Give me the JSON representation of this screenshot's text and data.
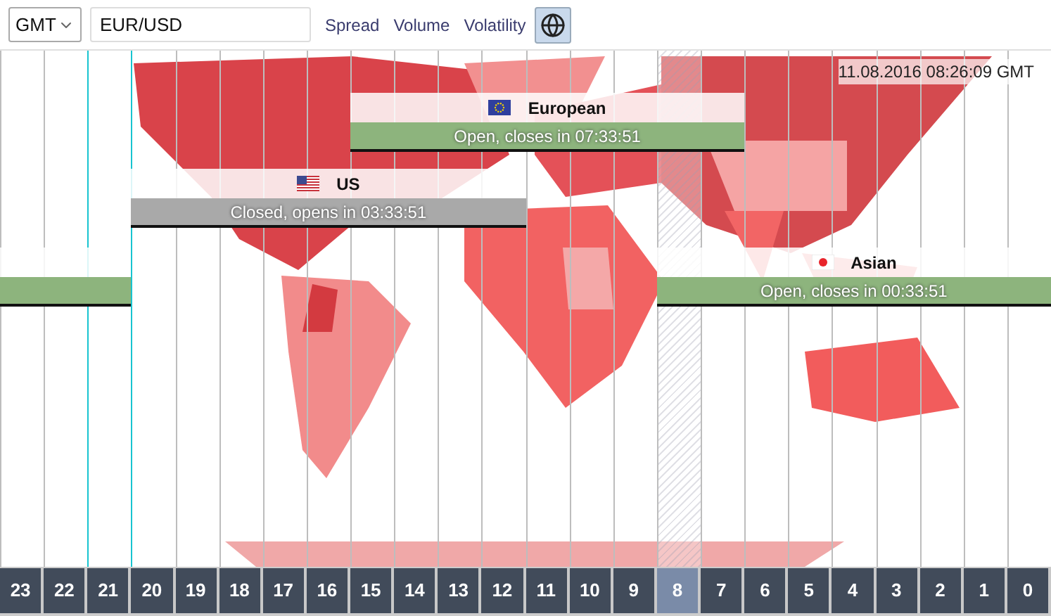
{
  "timezone": {
    "value": "GMT"
  },
  "symbol": {
    "value": "EUR/USD"
  },
  "links": [
    "Spread",
    "Volume",
    "Volatility"
  ],
  "globe_button": {
    "selected": true
  },
  "timestamp": "11.08.2016 08:26:09 GMT",
  "sessions": [
    {
      "name": "European",
      "kind": "eu",
      "open": true,
      "status": "Open, closes in 07:33:51"
    },
    {
      "name": "US",
      "kind": "us",
      "open": false,
      "status": "Closed, opens in 03:33:51"
    },
    {
      "name": "Asian",
      "kind": "jp",
      "open": true,
      "status": "Open, closes in 00:33:51"
    }
  ],
  "hours": [
    {
      "label": "23",
      "selected": false
    },
    {
      "label": "22",
      "selected": false
    },
    {
      "label": "21",
      "selected": false
    },
    {
      "label": "20",
      "selected": false
    },
    {
      "label": "19",
      "selected": false
    },
    {
      "label": "18",
      "selected": false
    },
    {
      "label": "17",
      "selected": false
    },
    {
      "label": "16",
      "selected": false
    },
    {
      "label": "15",
      "selected": false
    },
    {
      "label": "14",
      "selected": false
    },
    {
      "label": "13",
      "selected": false
    },
    {
      "label": "12",
      "selected": false
    },
    {
      "label": "11",
      "selected": false
    },
    {
      "label": "10",
      "selected": false
    },
    {
      "label": "9",
      "selected": false
    },
    {
      "label": "8",
      "selected": true
    },
    {
      "label": "7",
      "selected": false
    },
    {
      "label": "6",
      "selected": false
    },
    {
      "label": "5",
      "selected": false
    },
    {
      "label": "4",
      "selected": false
    },
    {
      "label": "3",
      "selected": false
    },
    {
      "label": "2",
      "selected": false
    },
    {
      "label": "1",
      "selected": false
    },
    {
      "label": "0",
      "selected": false
    }
  ]
}
